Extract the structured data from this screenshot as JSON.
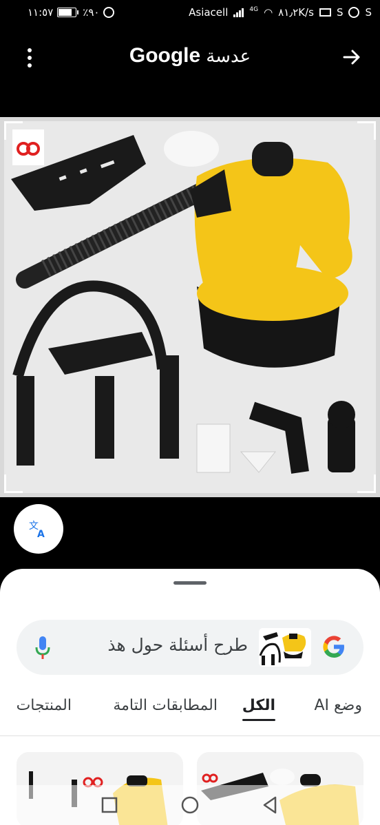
{
  "status_bar": {
    "time": "١١:٥٧",
    "battery": "٪٩٠",
    "icons_left": [
      "battery-icon",
      "alarm-icon"
    ],
    "speed": "٨١٫٢K/s",
    "network": "4G",
    "carrier": "Asiacell",
    "notif_letters": [
      "S",
      "S"
    ]
  },
  "app_bar": {
    "title_brand": "Google",
    "title_word": "عدسة",
    "menu_icon": "more-vert-icon",
    "share_icon": "arrow-forward-icon"
  },
  "image": {
    "subject": "steam-cleaner-product-photo",
    "colors": {
      "body": "#f4c518",
      "black": "#151515",
      "bg": "#e9e9e9"
    }
  },
  "translate": {
    "icon": "translate-icon"
  },
  "sheet": {
    "search_placeholder": "طرح أسئلة حول هذ",
    "tabs": [
      "وضع AI",
      "الكل",
      "المطابقات التامة",
      "المنتجات"
    ],
    "active_tab": "الكل"
  },
  "nav": {
    "icons": [
      "recent-apps-icon",
      "home-icon",
      "back-icon"
    ]
  }
}
